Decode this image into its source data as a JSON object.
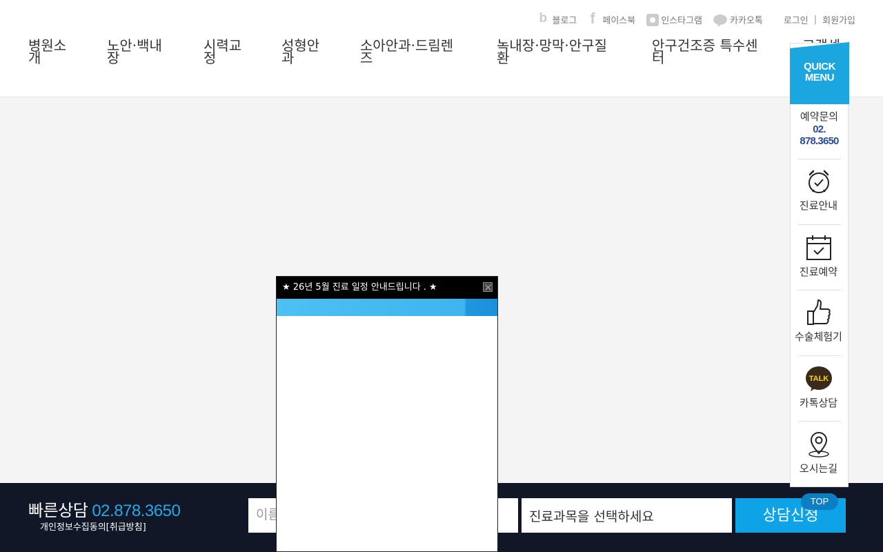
{
  "header": {
    "social": [
      {
        "label": "블로그",
        "icon": "blog-icon"
      },
      {
        "label": "페이스북",
        "icon": "facebook-icon"
      },
      {
        "label": "인스타그램",
        "icon": "instagram-icon"
      },
      {
        "label": "카카오톡",
        "icon": "kakaotalk-icon"
      }
    ],
    "login": "로그인",
    "separator": "|",
    "signup": "회원가입",
    "nav": [
      {
        "label": "병원소개"
      },
      {
        "label": "노안·백내장"
      },
      {
        "label": "시력교정"
      },
      {
        "label": "성형안과"
      },
      {
        "label": "소아안과·드림렌즈"
      },
      {
        "label": "녹내장·망막·안구질환"
      },
      {
        "label": "안구건조증 특수센터"
      },
      {
        "label": "고객센"
      }
    ]
  },
  "quick_menu": {
    "title_line1": "QUICK",
    "title_line2": "MENU",
    "reservation_label": "예약문의",
    "reservation_phone_1": "02.",
    "reservation_phone_2": "878.3650",
    "items": [
      {
        "label": "진료안내",
        "icon": "alarm-clock-icon"
      },
      {
        "label": "진료예약",
        "icon": "calendar-check-icon"
      },
      {
        "label": "수술체험기",
        "icon": "thumbs-up-icon"
      },
      {
        "label": "카톡상담",
        "icon": "kakao-talk-icon",
        "icon_text": "TALK"
      },
      {
        "label": "오시는길",
        "icon": "location-pin-icon"
      }
    ]
  },
  "popup": {
    "title": "★ 26년 5월 진료 일정 안내드립니다 . ★"
  },
  "consult": {
    "title": "빠른상담",
    "phone": "02.878.3650",
    "privacy": "개인정보수집동의[취급방침]",
    "name_placeholder": "이름",
    "subject_select": "진료과목을 선택하세요",
    "submit": "상담신청",
    "top": "TOP"
  },
  "colors": {
    "accent": "#0ea3e6",
    "quick_header": "#1ba6e0",
    "phone_blue": "#2a4a9e",
    "bottom_bar": "#111726"
  }
}
